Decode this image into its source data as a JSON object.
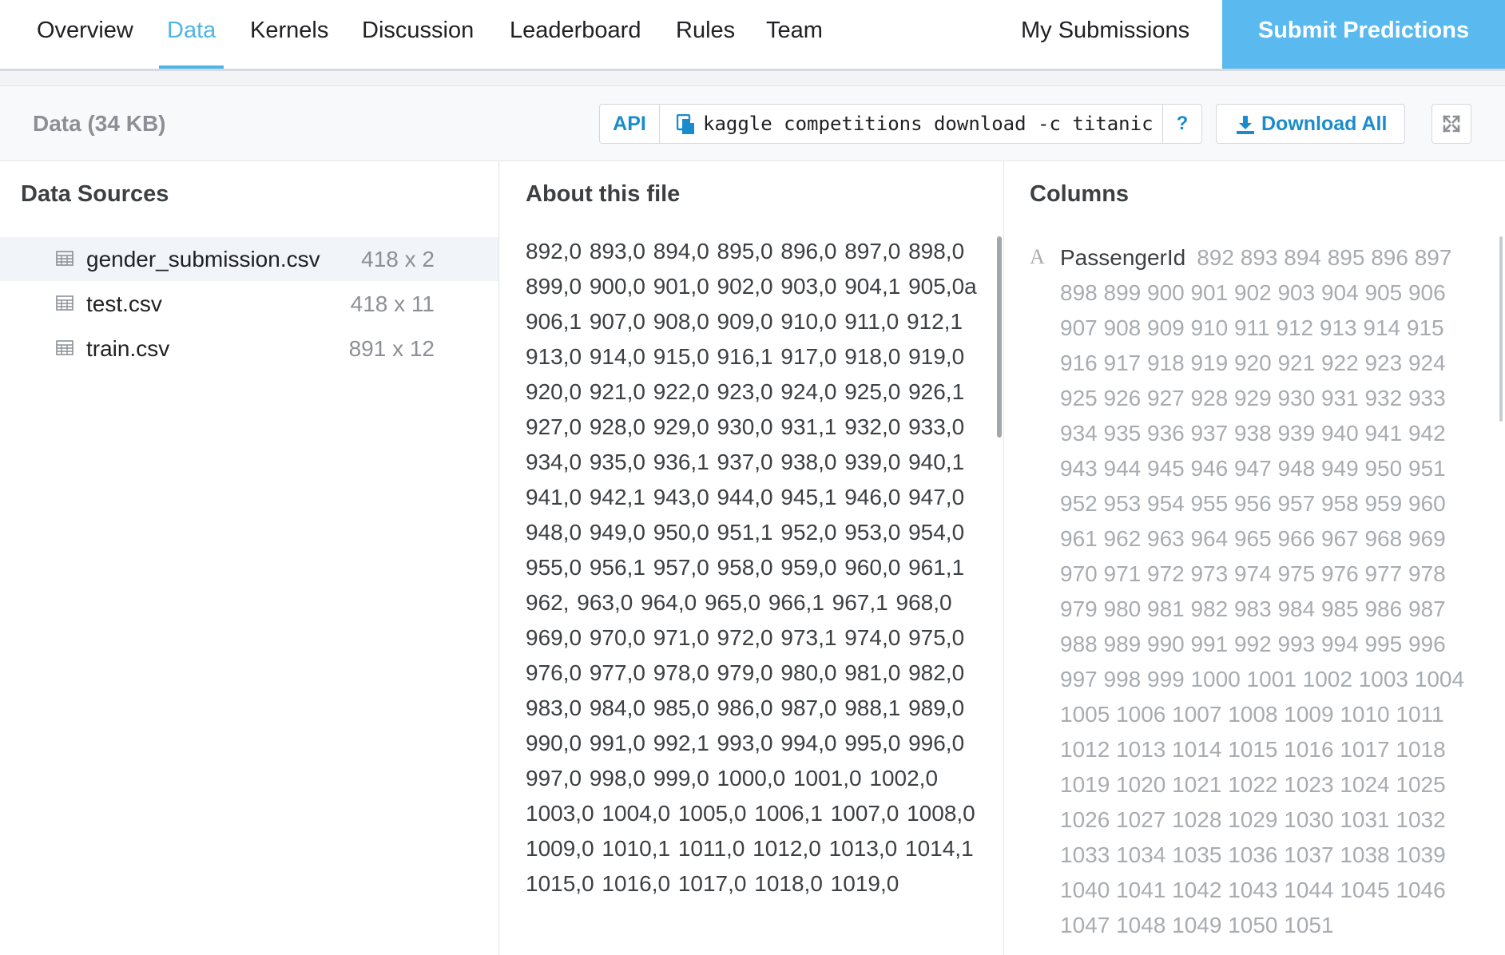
{
  "nav": {
    "tabs": [
      {
        "label": "Overview"
      },
      {
        "label": "Data"
      },
      {
        "label": "Kernels"
      },
      {
        "label": "Discussion"
      },
      {
        "label": "Leaderboard"
      },
      {
        "label": "Rules"
      },
      {
        "label": "Team"
      }
    ],
    "active_tab": "Data",
    "my_submissions": "My Submissions",
    "submit_predictions": "Submit Predictions"
  },
  "data_header": {
    "title": "Data (34 KB)",
    "api_label": "API",
    "cli_command": "kaggle competitions download -c titanic",
    "help_label": "?",
    "download_all": "Download All"
  },
  "data_sources": {
    "title": "Data Sources",
    "files": [
      {
        "name": "gender_submission.csv",
        "dims": "418 x 2",
        "selected": true
      },
      {
        "name": "test.csv",
        "dims": "418 x 11",
        "selected": false
      },
      {
        "name": "train.csv",
        "dims": "891 x 12",
        "selected": false
      }
    ]
  },
  "about_file": {
    "title": "About this file",
    "content": "892,0 893,0 894,0 895,0 896,0 897,0 898,0 899,0 900,0 901,0 902,0 903,0 904,1 905,0a 906,1 907,0 908,0 909,0 910,0 911,0 912,1 913,0 914,0 915,0 916,1 917,0 918,0 919,0 920,0 921,0 922,0 923,0 924,0 925,0 926,1 927,0 928,0 929,0 930,0 931,1 932,0 933,0 934,0 935,0 936,1 937,0 938,0 939,0 940,1 941,0 942,1 943,0 944,0 945,1 946,0 947,0 948,0 949,0 950,0 951,1 952,0 953,0 954,0 955,0 956,1 957,0 958,0 959,0 960,0 961,1 962, 963,0 964,0 965,0 966,1 967,1 968,0 969,0 970,0 971,0 972,0 973,1 974,0 975,0 976,0 977,0 978,0 979,0 980,0 981,0 982,0 983,0 984,0 985,0 986,0 987,0 988,1 989,0 990,0 991,0 992,1 993,0 994,0 995,0 996,0 997,0 998,0 999,0 1000,0 1001,0 1002,0 1003,0 1004,0 1005,0 1006,1 1007,0 1008,0 1009,0 1010,1 1011,0 1012,0 1013,0 1014,1 1015,0 1016,0 1017,0 1018,0 1019,0"
  },
  "columns": {
    "title": "Columns",
    "items": [
      {
        "type_icon": "A",
        "name": "PassengerId",
        "values": "892 893 894 895 896 897 898 899 900 901 902 903 904 905 906 907 908 909 910 911 912 913 914 915 916 917 918 919 920 921 922 923 924 925 926 927 928 929 930 931 932 933 934 935 936 937 938 939 940 941 942 943 944 945 946 947 948 949 950 951 952 953 954 955 956 957 958 959 960 961 962 963 964 965 966 967 968 969 970 971 972 973 974 975 976 977 978 979 980 981 982 983 984 985 986 987 988 989 990 991 992 993 994 995 996 997 998 999 1000 1001 1002 1003 1004 1005 1006 1007 1008 1009 1010 1011 1012 1013 1014 1015 1016 1017 1018 1019 1020 1021 1022 1023 1024 1025 1026 1027 1028 1029 1030 1031 1032 1033 1034 1035 1036 1037 1038 1039 1040 1041 1042 1043 1044 1045 1046 1047 1048 1049 1050 1051"
      }
    ]
  },
  "colors": {
    "accent": "#4fb5e5",
    "submit_bg": "#5ab9ee",
    "link": "#1a8ccc",
    "muted": "#8c9096"
  },
  "icons": [
    "table-icon",
    "copy-icon",
    "download-icon",
    "expand-icon",
    "string-type-icon"
  ]
}
